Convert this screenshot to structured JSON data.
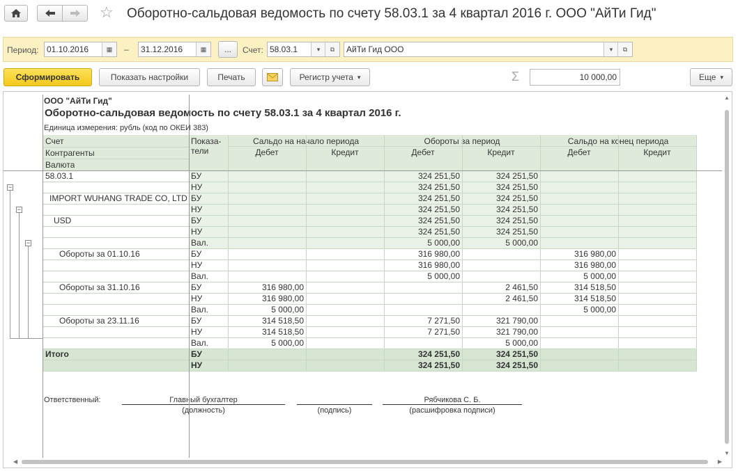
{
  "window": {
    "title": "Оборотно-сальдовая ведомость по счету 58.03.1 за 4 квартал 2016 г. ООО \"АйТи Гид\""
  },
  "filters": {
    "period_label": "Период:",
    "date_from": "01.10.2016",
    "dash": "–",
    "date_to": "31.12.2016",
    "ellipsis": "...",
    "account_label": "Счет:",
    "account_value": "58.03.1",
    "organization": "АйТи Гид ООО"
  },
  "toolbar": {
    "generate": "Сформировать",
    "show_settings": "Показать настройки",
    "print": "Печать",
    "register": "Регистр учета",
    "sum_value": "10 000,00",
    "more": "Еще"
  },
  "report": {
    "org": "ООО \"АйТи Гид\"",
    "title": "Оборотно-сальдовая ведомость по счету 58.03.1 за 4 квартал 2016 г.",
    "unit": "Единица измерения:   рубль (код по ОКЕИ 383)",
    "headers": {
      "account": "Счет",
      "counterparties": "Контрагенты",
      "currency": "Валюта",
      "indicators_1": "Показа-",
      "indicators_2": "тели",
      "opening": "Сальдо на начало периода",
      "turnover": "Обороты за период",
      "closing": "Сальдо на конец периода",
      "debit": "Дебет",
      "credit": "Кредит"
    },
    "rows": [
      {
        "label": "58.03.1",
        "ind": "БУ",
        "v": [
          "",
          "",
          "324 251,50",
          "324 251,50",
          "",
          ""
        ]
      },
      {
        "label": "",
        "ind": "НУ",
        "v": [
          "",
          "",
          "324 251,50",
          "324 251,50",
          "",
          ""
        ]
      },
      {
        "label": "IMPORT WUHANG TRADE CO, LTD",
        "ind": "БУ",
        "v": [
          "",
          "",
          "324 251,50",
          "324 251,50",
          "",
          ""
        ]
      },
      {
        "label": "",
        "ind": "НУ",
        "v": [
          "",
          "",
          "324 251,50",
          "324 251,50",
          "",
          ""
        ]
      },
      {
        "label": "USD",
        "ind": "БУ",
        "v": [
          "",
          "",
          "324 251,50",
          "324 251,50",
          "",
          ""
        ]
      },
      {
        "label": "",
        "ind": "НУ",
        "v": [
          "",
          "",
          "324 251,50",
          "324 251,50",
          "",
          ""
        ]
      },
      {
        "label": "",
        "ind": "Вал.",
        "v": [
          "",
          "",
          "5 000,00",
          "5 000,00",
          "",
          ""
        ]
      },
      {
        "label": "Обороты за 01.10.16",
        "ind": "БУ",
        "v": [
          "",
          "",
          "316 980,00",
          "",
          "316 980,00",
          ""
        ]
      },
      {
        "label": "",
        "ind": "НУ",
        "v": [
          "",
          "",
          "316 980,00",
          "",
          "316 980,00",
          ""
        ]
      },
      {
        "label": "",
        "ind": "Вал.",
        "v": [
          "",
          "",
          "5 000,00",
          "",
          "5 000,00",
          ""
        ]
      },
      {
        "label": "Обороты за 31.10.16",
        "ind": "БУ",
        "v": [
          "316 980,00",
          "",
          "",
          "2 461,50",
          "314 518,50",
          ""
        ]
      },
      {
        "label": "",
        "ind": "НУ",
        "v": [
          "316 980,00",
          "",
          "",
          "2 461,50",
          "314 518,50",
          ""
        ]
      },
      {
        "label": "",
        "ind": "Вал.",
        "v": [
          "5 000,00",
          "",
          "",
          "",
          "5 000,00",
          ""
        ]
      },
      {
        "label": "Обороты за 23.11.16",
        "ind": "БУ",
        "v": [
          "314 518,50",
          "",
          "7 271,50",
          "321 790,00",
          "",
          ""
        ]
      },
      {
        "label": "",
        "ind": "НУ",
        "v": [
          "314 518,50",
          "",
          "7 271,50",
          "321 790,00",
          "",
          ""
        ]
      },
      {
        "label": "",
        "ind": "Вал.",
        "v": [
          "5 000,00",
          "",
          "",
          "5 000,00",
          "",
          ""
        ]
      },
      {
        "label": "Итого",
        "ind": "БУ",
        "v": [
          "",
          "",
          "324 251,50",
          "324 251,50",
          "",
          ""
        ]
      },
      {
        "label": "",
        "ind": "НУ",
        "v": [
          "",
          "",
          "324 251,50",
          "324 251,50",
          "",
          ""
        ]
      }
    ],
    "signature": {
      "responsible": "Ответственный:",
      "position_value": "Главный бухгалтер",
      "position_caption": "(должность)",
      "sign_caption": "(подпись)",
      "name_value": "Рябчикова С. Б.",
      "name_caption": "(расшифровка подписи)"
    }
  }
}
